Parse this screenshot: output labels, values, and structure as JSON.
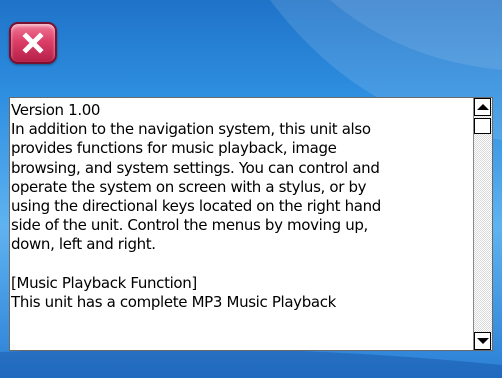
{
  "close_button": {
    "icon": "close-icon"
  },
  "info_text": {
    "lines": [
      "Version 1.00",
      "In addition to the navigation system, this unit also",
      "provides functions for music playback, image",
      "browsing, and system settings. You can control and",
      "operate the system on screen with a stylus, or by",
      "using the directional keys located on the right hand",
      "side of the unit. Control the menus by moving up,",
      "down, left and right.",
      "",
      "[Music Playback Function]",
      "This unit has a complete MP3 Music Playback"
    ]
  },
  "scrollbar": {
    "up_icon": "arrow-up-icon",
    "down_icon": "arrow-down-icon",
    "position": 0.0
  },
  "colors": {
    "background": "#2e8ee0",
    "close_button": "#dc3f68"
  }
}
